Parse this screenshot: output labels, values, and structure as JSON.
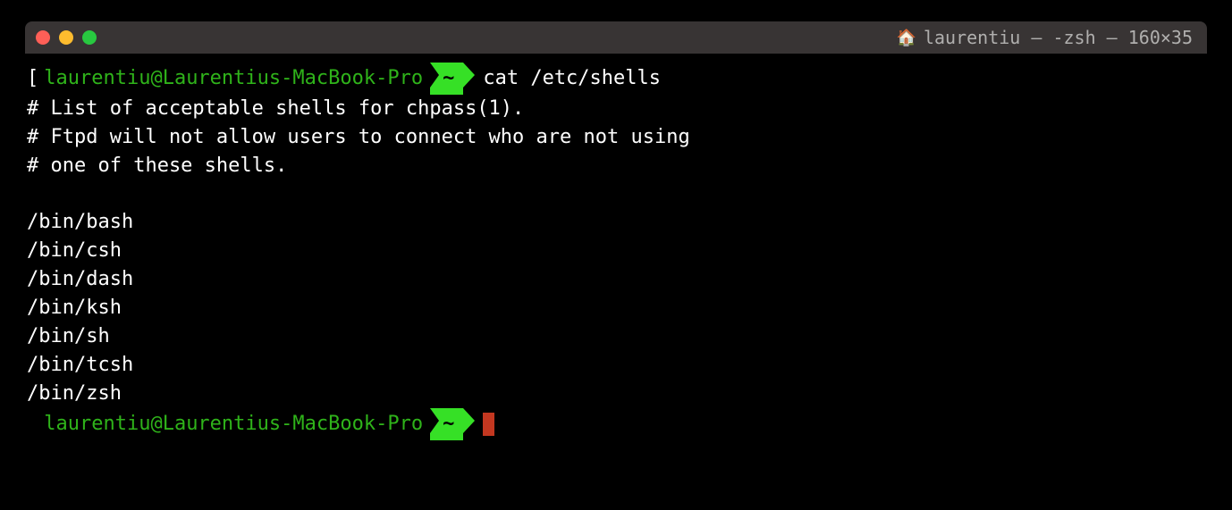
{
  "titlebar": {
    "title": "laurentiu — -zsh — 160×35",
    "home_icon": "🏠"
  },
  "prompt": {
    "bracket": "[",
    "user_host": "laurentiu@Laurentius-MacBook-Pro",
    "cwd_badge": "~",
    "command": "cat /etc/shells"
  },
  "output": {
    "lines": [
      "# List of acceptable shells for chpass(1).",
      "# Ftpd will not allow users to connect who are not using",
      "# one of these shells.",
      "",
      "/bin/bash",
      "/bin/csh",
      "/bin/dash",
      "/bin/ksh",
      "/bin/sh",
      "/bin/tcsh",
      "/bin/zsh"
    ]
  },
  "prompt2": {
    "user_host": "laurentiu@Laurentius-MacBook-Pro",
    "cwd_badge": "~"
  }
}
